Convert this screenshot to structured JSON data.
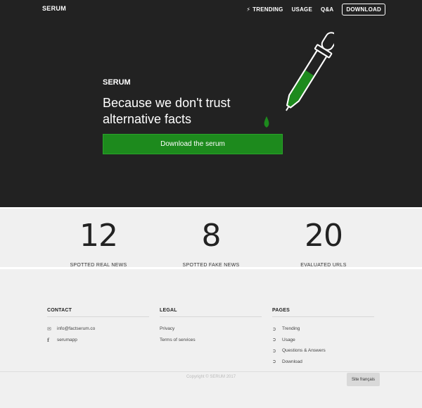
{
  "nav": {
    "brand": "SERUM",
    "items": [
      {
        "label": "TRENDING",
        "icon": "bolt-icon"
      },
      {
        "label": "USAGE"
      },
      {
        "label": "Q&A"
      }
    ],
    "download": "DOWNLOAD"
  },
  "hero": {
    "title": "SERUM",
    "tagline": "Because we don't trust alternative facts",
    "cta": "Download the serum",
    "accent": "#1d8a1d"
  },
  "stats": [
    {
      "value": "12",
      "label": "SPOTTED REAL NEWS"
    },
    {
      "value": "8",
      "label": "SPOTTED FAKE NEWS"
    },
    {
      "value": "20",
      "label": "EVALUATED URLS"
    }
  ],
  "footer": {
    "contact": {
      "heading": "CONTACT",
      "items": [
        {
          "text": "info@factserum.co",
          "icon": "envelope-icon"
        },
        {
          "text": "serumapp",
          "icon": "facebook-icon"
        }
      ]
    },
    "legal": {
      "heading": "LEGAL",
      "items": [
        "Privacy",
        "Terms of services"
      ]
    },
    "pages": {
      "heading": "PAGES",
      "items": [
        "Trending",
        "Usage",
        "Questions & Answers",
        "Download"
      ]
    },
    "copyright": "Copyright © SERUM 2017",
    "language_button": "Site français"
  }
}
